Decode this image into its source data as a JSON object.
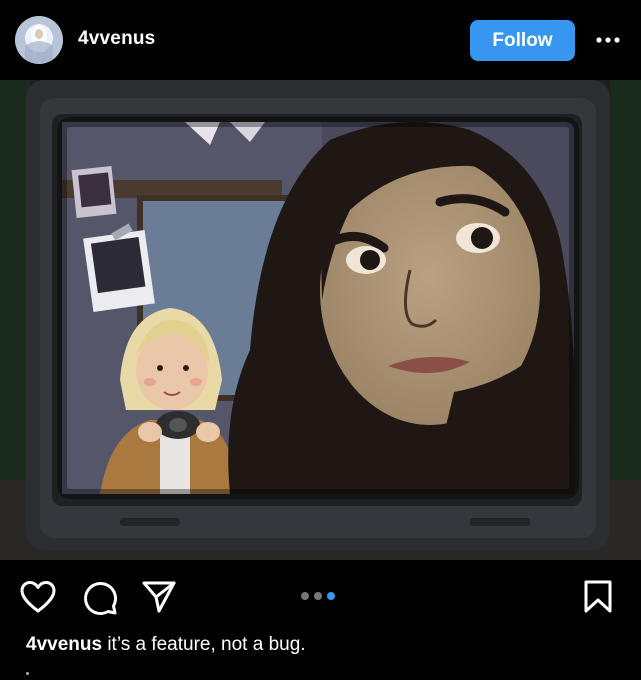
{
  "post": {
    "username": "4vvenus",
    "follow_label": "Follow",
    "more_icon": "more-horizontal-icon",
    "image_description_alt": "",
    "carousel": {
      "count": 3,
      "active_index": 2
    },
    "caption": {
      "username": "4vvenus",
      "text": "it’s a feature, not a bug."
    }
  },
  "actions": {
    "like_icon": "heart-icon",
    "comment_icon": "comment-icon",
    "share_icon": "send-icon",
    "save_icon": "bookmark-icon"
  },
  "colors": {
    "background": "#000000",
    "text": "#ffffff",
    "follow_button": "#3797f0",
    "active_dot": "#3797f0",
    "inactive_dot": "#777777"
  }
}
